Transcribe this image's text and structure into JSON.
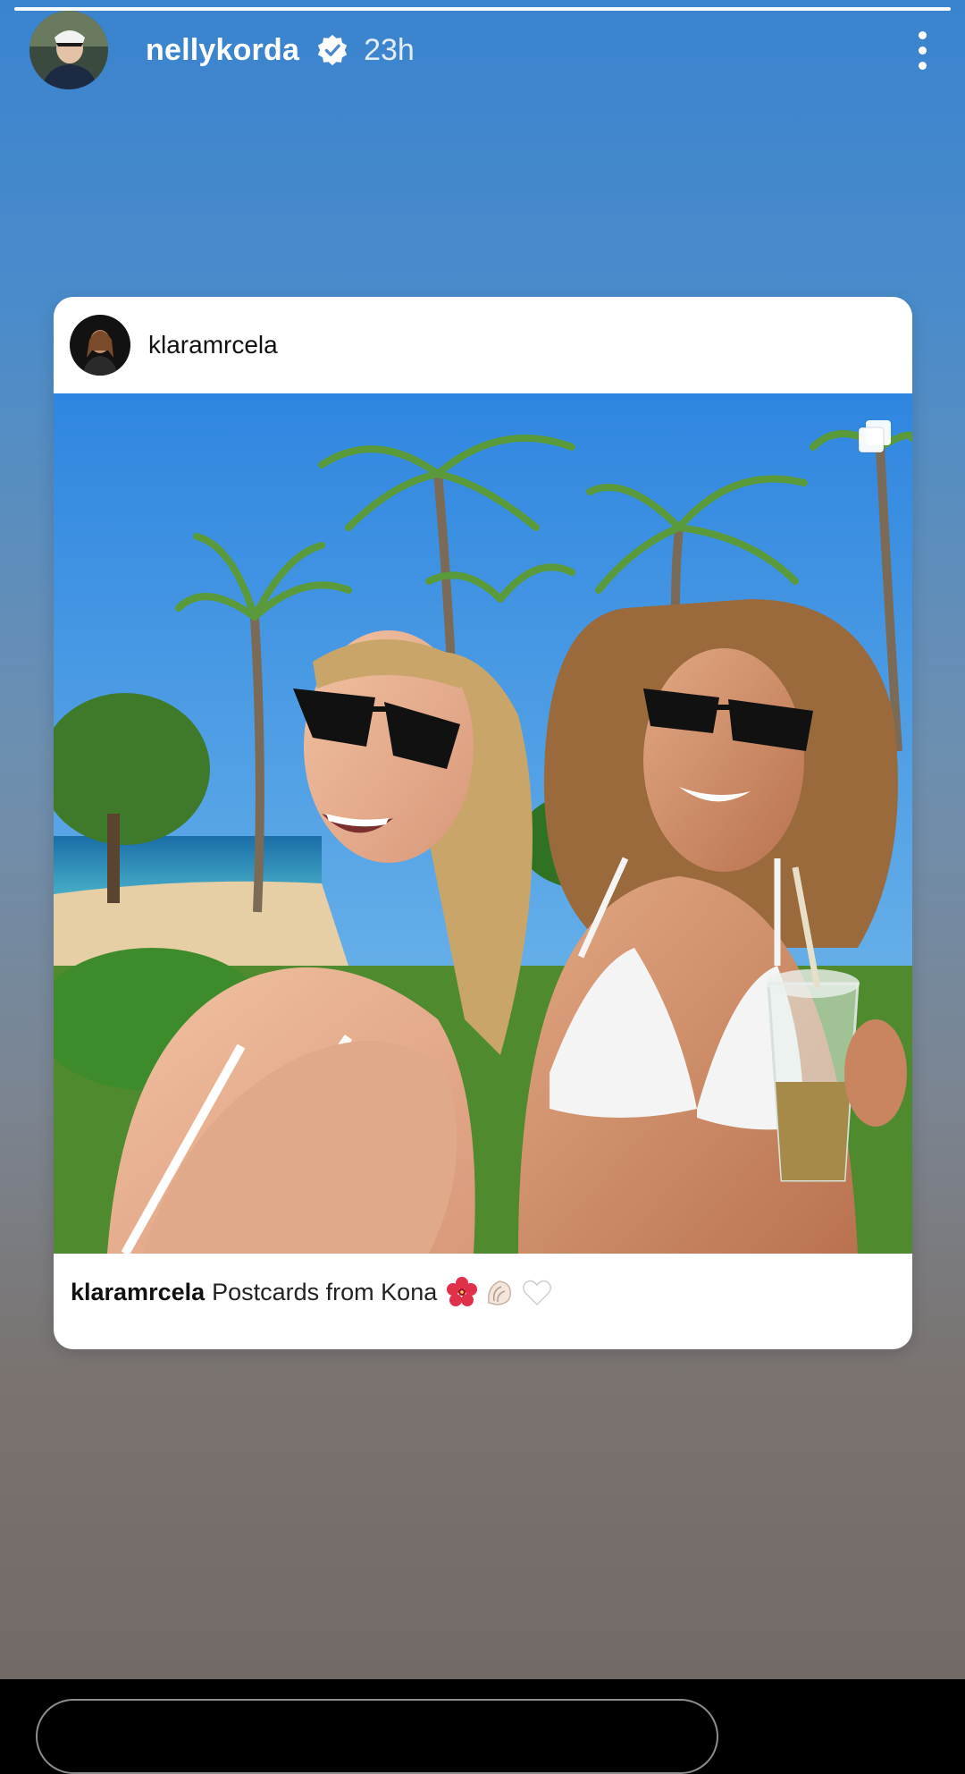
{
  "story": {
    "username": "nellykorda",
    "time_ago": "23h",
    "progress": 1.0
  },
  "shared_post": {
    "username": "klaramrcela",
    "caption_user": "klaramrcela",
    "caption_text": "Postcards from Kona",
    "caption_emojis": [
      "hibiscus-icon",
      "shell-icon",
      "white-heart-icon"
    ]
  },
  "icons": {
    "verified": "verified-badge-icon",
    "more": "more-options-icon",
    "multi_image": "carousel-icon"
  },
  "colors": {
    "verified_badge": "#ffffff",
    "background_top": "#3a83cf",
    "background_bottom": "#726a67"
  }
}
